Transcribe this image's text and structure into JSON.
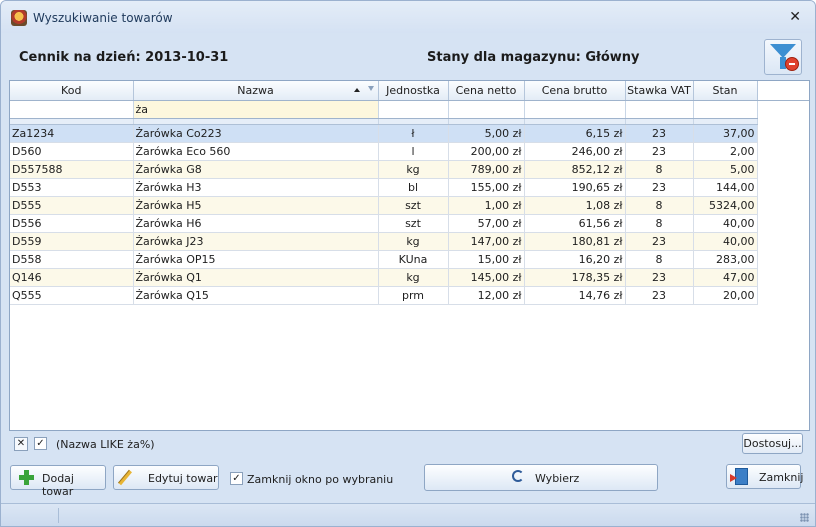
{
  "window": {
    "title": "Wyszukiwanie towarów",
    "close_glyph": "✕"
  },
  "header": {
    "price_list_label": "Cennik na dzień: 2013-10-31",
    "warehouse_label": "Stany dla magazynu: Główny"
  },
  "table": {
    "columns": [
      "Kod",
      "Nazwa",
      "Jednostka",
      "Cena netto",
      "Cena brutto",
      "Stawka VAT",
      "Stan"
    ],
    "filter_value": "ża",
    "rows": [
      [
        "Za1234",
        "Żarówka Co223",
        "ł",
        "5,00 zł",
        "6,15 zł",
        "23",
        "37,00"
      ],
      [
        "D560",
        "Żarówka Eco 560",
        "l",
        "200,00 zł",
        "246,00 zł",
        "23",
        "2,00"
      ],
      [
        "D557588",
        "Żarówka G8",
        "kg",
        "789,00 zł",
        "852,12 zł",
        "8",
        "5,00"
      ],
      [
        "D553",
        "Żarówka H3",
        "bl",
        "155,00 zł",
        "190,65 zł",
        "23",
        "144,00"
      ],
      [
        "D555",
        "Żarówka H5",
        "szt",
        "1,00 zł",
        "1,08 zł",
        "8",
        "5324,00"
      ],
      [
        "D556",
        "Żarówka H6",
        "szt",
        "57,00 zł",
        "61,56 zł",
        "8",
        "40,00"
      ],
      [
        "D559",
        "Żarówka J23",
        "kg",
        "147,00 zł",
        "180,81 zł",
        "23",
        "40,00"
      ],
      [
        "D558",
        "Żarówka OP15",
        "KUna",
        "15,00 zł",
        "16,20 zł",
        "8",
        "283,00"
      ],
      [
        "Q146",
        "Żarówka Q1",
        "kg",
        "145,00 zł",
        "178,35 zł",
        "23",
        "47,00"
      ],
      [
        "Q555",
        "Żarówka Q15",
        "prm",
        "12,00 zł",
        "14,76 zł",
        "23",
        "20,00"
      ]
    ]
  },
  "filter_bar": {
    "clear_glyph": "✕",
    "check_glyph": "✓",
    "expression": "(Nazwa LIKE ża%)",
    "customize_label": "Dostosuj..."
  },
  "footer": {
    "add_label": "Dodaj towar",
    "edit_label": "Edytuj towar",
    "close_after_select_label": "Zamknij okno po wybraniu",
    "close_after_select_checked": true,
    "check_glyph": "✓",
    "select_label": "Wybierz",
    "close_label": "Zamknij"
  }
}
